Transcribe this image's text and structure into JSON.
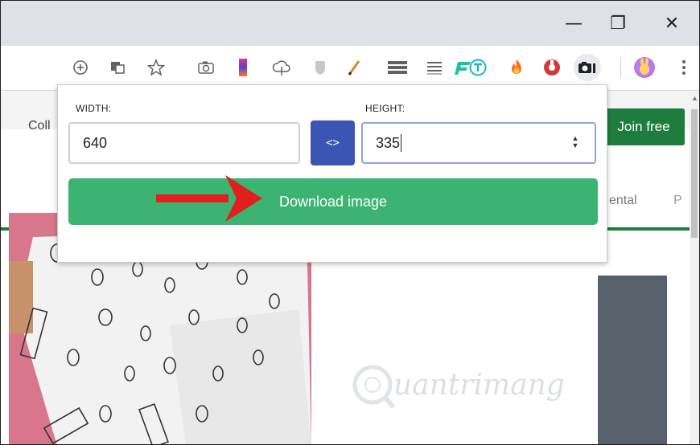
{
  "window": {
    "minimize_glyph": "—",
    "maximize_glyph": "❐",
    "close_glyph": "✕"
  },
  "toolbar": {
    "icons": [
      "zoom-plus-icon",
      "translate-icon",
      "star-icon",
      "camera-icon",
      "color-picker-icon",
      "cloud-upload-icon",
      "shield-icon",
      "pencil-icon",
      "menu-bars-icon",
      "list-icon",
      "f-logo-icon",
      "t-circle-icon",
      "fire-icon",
      "gear-red-icon",
      "screenshot-camera-icon",
      "profile-bunny-icon",
      "more-menu-icon"
    ]
  },
  "page": {
    "partial_collection_text": "Coll",
    "join_button": "Join free",
    "nav_text_partial": "ental",
    "nav_text_partial2": "P",
    "watermark_text": "uantrimang"
  },
  "popup": {
    "width_label": "WIDTH:",
    "height_label": "HEIGHT:",
    "width_value": "640",
    "height_value": "335",
    "swap_button": "<>",
    "download_button": "Download image"
  },
  "colors": {
    "swap_blue": "#3a55b4",
    "download_green": "#3cb371",
    "join_green": "#1e7d3e",
    "arrow_red": "#e31e1e"
  }
}
